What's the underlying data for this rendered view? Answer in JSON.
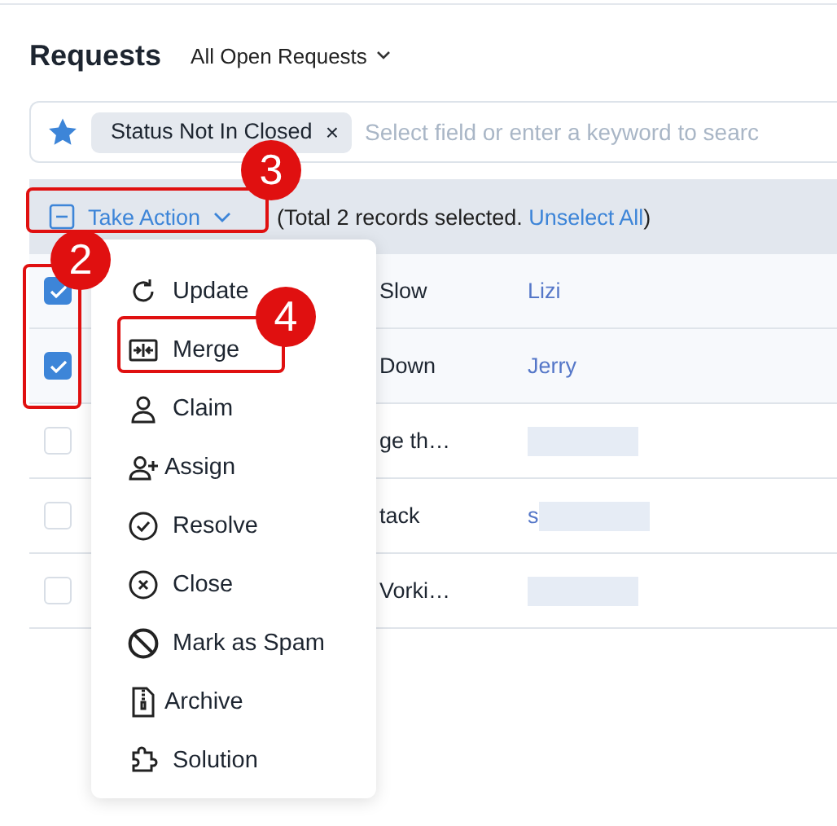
{
  "header": {
    "title": "Requests",
    "view": "All Open Requests"
  },
  "filter_bar": {
    "chip": "Status Not In Closed",
    "chip_close": "×",
    "placeholder": "Select field or enter a keyword to searc"
  },
  "action_bar": {
    "button": "Take Action",
    "summary_before": "(Total 2 records selected. ",
    "link": "Unselect All",
    "summary_after": ")"
  },
  "rows": [
    {
      "checked": true,
      "subject": "Slow",
      "requester": "Lizi",
      "redacted": false
    },
    {
      "checked": true,
      "subject": "Down",
      "requester": "Jerry",
      "redacted": false
    },
    {
      "checked": false,
      "subject": "ge th…",
      "redacted": true
    },
    {
      "checked": false,
      "subject": "tack",
      "requester": "s",
      "redacted": true
    },
    {
      "checked": false,
      "subject": "Vorki…",
      "redacted": true
    }
  ],
  "menu": [
    {
      "label": "Update"
    },
    {
      "label": "Merge"
    },
    {
      "label": "Claim"
    },
    {
      "label": "Assign"
    },
    {
      "label": "Resolve"
    },
    {
      "label": "Close"
    },
    {
      "label": "Mark as Spam"
    },
    {
      "label": "Archive"
    },
    {
      "label": "Solution"
    }
  ],
  "annotations": [
    {
      "number": "2"
    },
    {
      "number": "3"
    },
    {
      "number": "4"
    }
  ]
}
